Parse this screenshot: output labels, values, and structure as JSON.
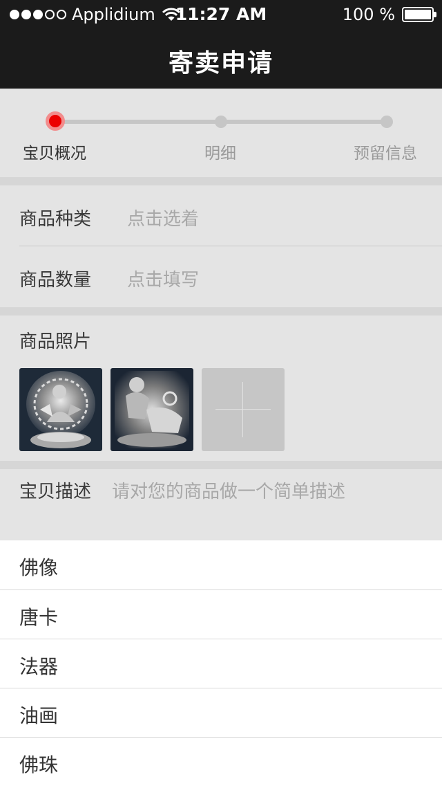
{
  "status_bar": {
    "carrier": "Applidium",
    "time": "11:27 AM",
    "battery": "100 %"
  },
  "nav": {
    "title": "寄卖申请"
  },
  "stepper": {
    "steps": [
      "宝贝概况",
      "明细",
      "预留信息"
    ],
    "active_step": 1,
    "active_color": "#ec0000"
  },
  "form": {
    "category": {
      "label": "商品种类",
      "placeholder": "点击选着"
    },
    "quantity": {
      "label": "商品数量",
      "placeholder": "点击填写"
    },
    "photos": {
      "label": "商品照片",
      "icon": "plus-icon"
    },
    "description": {
      "label": "宝贝描述",
      "placeholder": "请对您的商品做一个简单描述"
    }
  },
  "category_list": [
    "佛像",
    "唐卡",
    "法器",
    "油画",
    "佛珠"
  ]
}
